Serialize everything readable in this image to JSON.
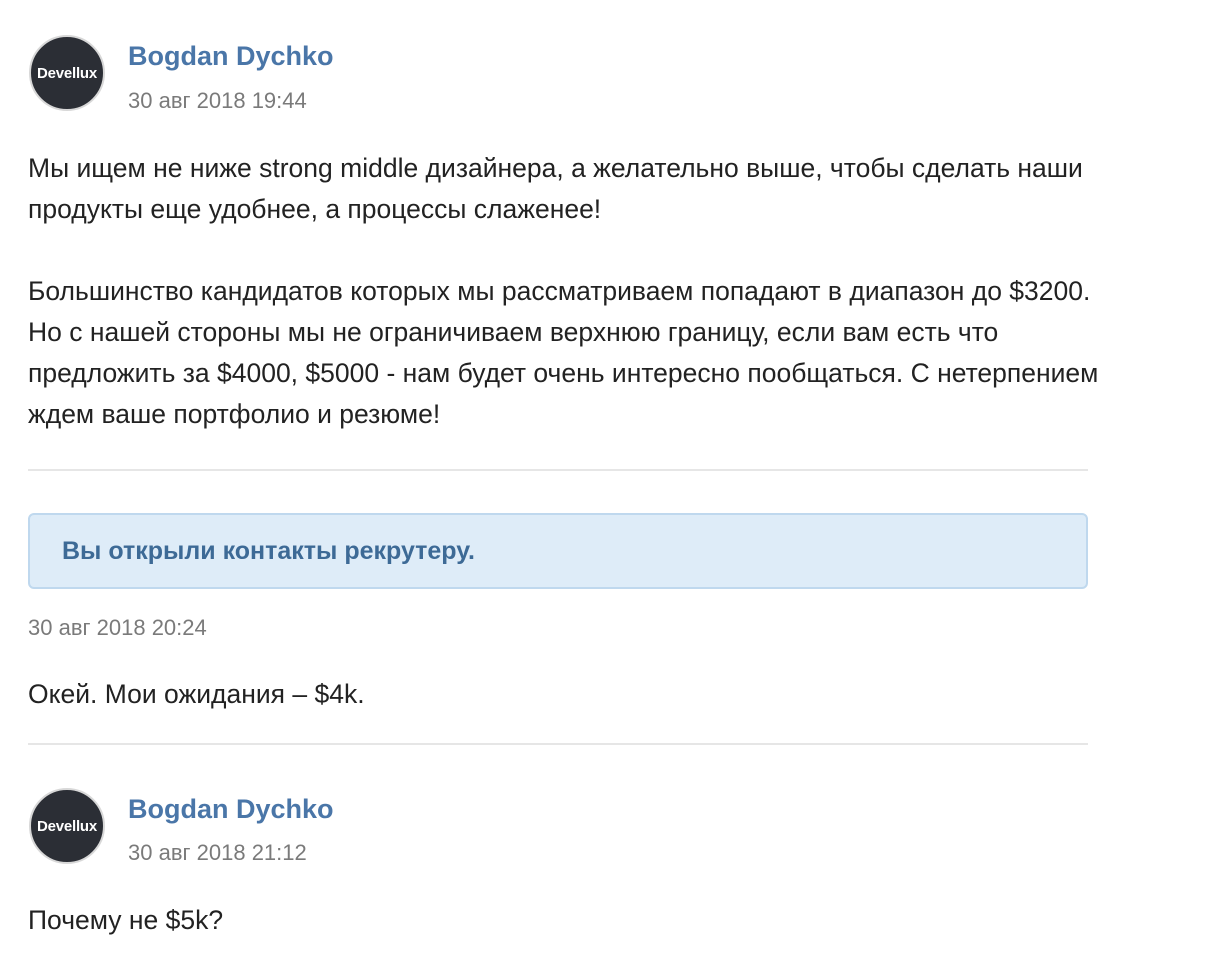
{
  "messages": [
    {
      "avatar_text": "Devellux",
      "author": "Bogdan Dychko",
      "time": "30 авг 2018 19:44",
      "paragraphs": [
        "Мы ищем не ниже strong middle дизайнера, а желательно выше, чтобы сделать наши продукты еще удобнее, а процессы слаженее!",
        "Большинство кандидатов которых мы рассматриваем попадают в диапазон до $3200. Но с нашей стороны мы не ограничиваем верхнюю границу, если вам есть что предложить за $4000, $5000 - нам будет очень интересно пообщаться. С нетерпением ждем ваше портфолио и резюме!"
      ]
    },
    {
      "notice": "Вы открыли контакты рекрутеру.",
      "time": "30 авг 2018 20:24",
      "text": "Окей. Мои ожидания – $4k."
    },
    {
      "avatar_text": "Devellux",
      "author": "Bogdan Dychko",
      "time": "30 авг 2018 21:12",
      "text": "Почему не $5k?"
    }
  ]
}
